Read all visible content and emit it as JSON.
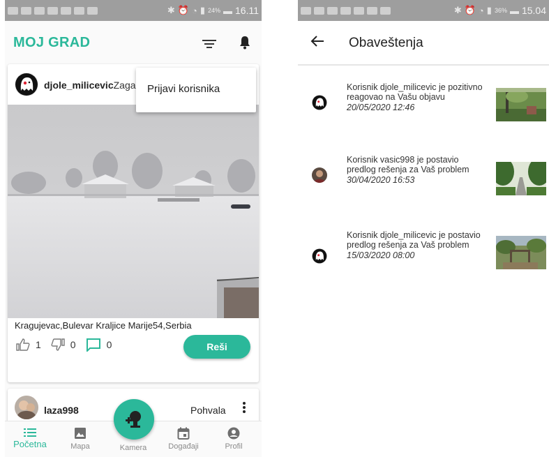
{
  "left": {
    "status": {
      "battery": "24%",
      "time": "16.11"
    },
    "app_title": "MOJ GRAD",
    "post": {
      "username": "djole_milicevic",
      "username_rest": "Zagad",
      "location": "Kragujevac,Bulevar Kraljice Marije54,Serbia",
      "likes": "1",
      "dislikes": "0",
      "comments": "0",
      "solve_label": "Reši"
    },
    "menu": {
      "report_user": "Prijavi korisnika"
    },
    "post2": {
      "username": "laza998",
      "tag": "Pohvala"
    },
    "nav": {
      "items": [
        "Početna",
        "Mapa",
        "Kamera",
        "Događaji",
        "Profil"
      ]
    }
  },
  "right": {
    "status": {
      "battery": "36%",
      "time": "15.04"
    },
    "title": "Obaveštenja",
    "notifications": [
      {
        "text": "Korisnik djole_milicevic je pozitivno reagovao na Vašu objavu",
        "date": "20/05/2020 12:46"
      },
      {
        "text": "Korisnik vasic998 je postavio predlog rešenja za Vaš problem",
        "date": "30/04/2020 16:53"
      },
      {
        "text": "Korisnik djole_milicevic je postavio predlog rešenja za Vaš problem",
        "date": "15/03/2020 08:00"
      }
    ]
  },
  "colors": {
    "accent": "#2bb89a",
    "status_bar": "#9e9e9e"
  }
}
